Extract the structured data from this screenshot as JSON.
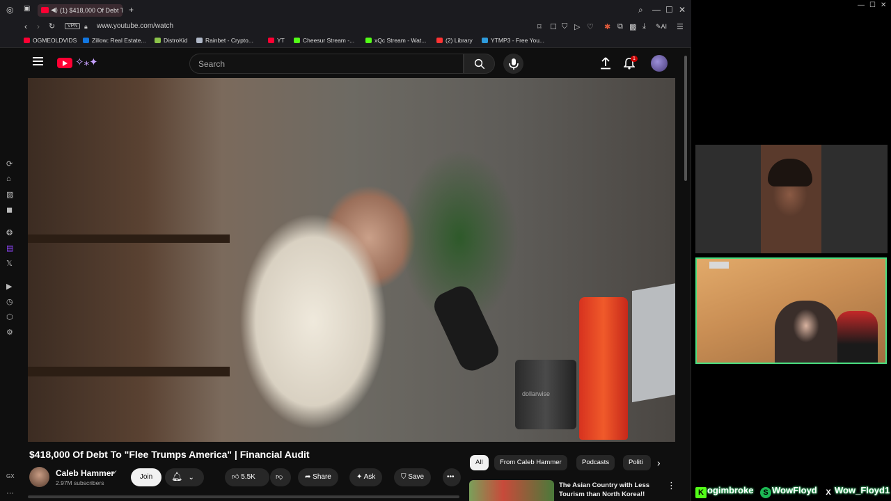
{
  "browser": {
    "tab_title": "(1) $418,000 Of Debt T",
    "url": "www.youtube.com/watch",
    "vpn_label": "VPN",
    "ai_label": "AI",
    "new_tab": "+"
  },
  "bookmarks": [
    {
      "label": "OGMEOLDVIDS",
      "color": "#ff0033"
    },
    {
      "label": "Zillow: Real Estate...",
      "color": "#1277e1"
    },
    {
      "label": "DistroKid",
      "color": "#8bc34a"
    },
    {
      "label": "Rainbet - Crypto...",
      "color": "#b0b8c8"
    },
    {
      "label": "YT",
      "color": "#ff0033"
    },
    {
      "label": "Cheesur Stream -...",
      "color": "#53fc18"
    },
    {
      "label": "xQc Stream - Wat...",
      "color": "#53fc18"
    },
    {
      "label": "(2) Library",
      "color": "#ff3333"
    },
    {
      "label": "YTMP3 - Free You...",
      "color": "#2e9bdc"
    }
  ],
  "youtube": {
    "search_placeholder": "Search",
    "notification_count": "1",
    "video_title": "$418,000 Of Debt To \"Flee Trumps America\" | Financial Audit",
    "mug_text": "dollarwise",
    "channel": {
      "name": "Caleb Hammer",
      "subscribers": "2.97M subscribers",
      "join_label": "Join"
    },
    "actions": {
      "likes": "5.5K",
      "share": "Share",
      "ask": "Ask",
      "save": "Save"
    },
    "chips": [
      "All",
      "From Caleb Hammer",
      "Podcasts",
      "Politi"
    ],
    "recommendation": {
      "title": "The Asian Country with Less Tourism than North Korea!!"
    }
  },
  "overlay": {
    "socials": [
      {
        "icon": "K",
        "label": "ogimbroke"
      },
      {
        "icon": "S",
        "label": "WowFloyd"
      },
      {
        "icon": "X",
        "label": "Wow_Floyd1"
      }
    ]
  }
}
